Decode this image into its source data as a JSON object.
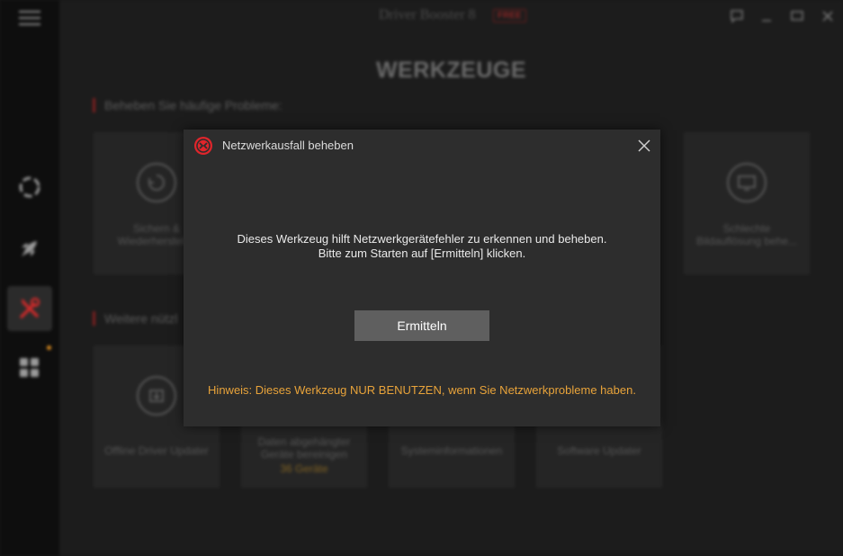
{
  "app": {
    "title": "Driver Booster 8",
    "badge": "FREE"
  },
  "sidebar": {
    "items": [
      {
        "icon": "refresh-ring-icon"
      },
      {
        "icon": "rocket-icon"
      },
      {
        "icon": "tools-icon",
        "active": true
      },
      {
        "icon": "grid-icon"
      }
    ],
    "notification_color": "#d88a1f"
  },
  "window_controls": [
    "feedback-icon",
    "minimize-icon",
    "maximize-icon",
    "close-icon"
  ],
  "main": {
    "title": "WERKZEUGE",
    "section1_title": "Beheben Sie häufige Probleme:",
    "section1_cards": [
      {
        "label_line1": "Sichern &",
        "label_line2": "Wiederherstell..."
      },
      {
        "label_line1": "Schlechte",
        "label_line2": "Bildauflösung behe..."
      }
    ],
    "section2_title": "Weitere nützl",
    "section2_cards": [
      {
        "label": "Offline Driver Updater"
      },
      {
        "label_line1": "Daten abgehängter",
        "label_line2": "Geräte bereinigen",
        "sub": "36 Geräte"
      },
      {
        "label": "Systeminformationen"
      },
      {
        "label": "Software Updater"
      }
    ]
  },
  "dialog": {
    "title": "Netzwerkausfall beheben",
    "message_line1": "Dieses Werkzeug hilft Netzwerkgerätefehler zu erkennen und beheben.",
    "message_line2": "Bitte zum Starten auf [Ermitteln] klicken.",
    "button_label": "Ermitteln",
    "hint": "Hinweis: Dieses Werkzeug NUR BENUTZEN, wenn Sie Netzwerkprobleme haben.",
    "accent_color": "#e8a33a",
    "brand_color": "#e0252b"
  }
}
